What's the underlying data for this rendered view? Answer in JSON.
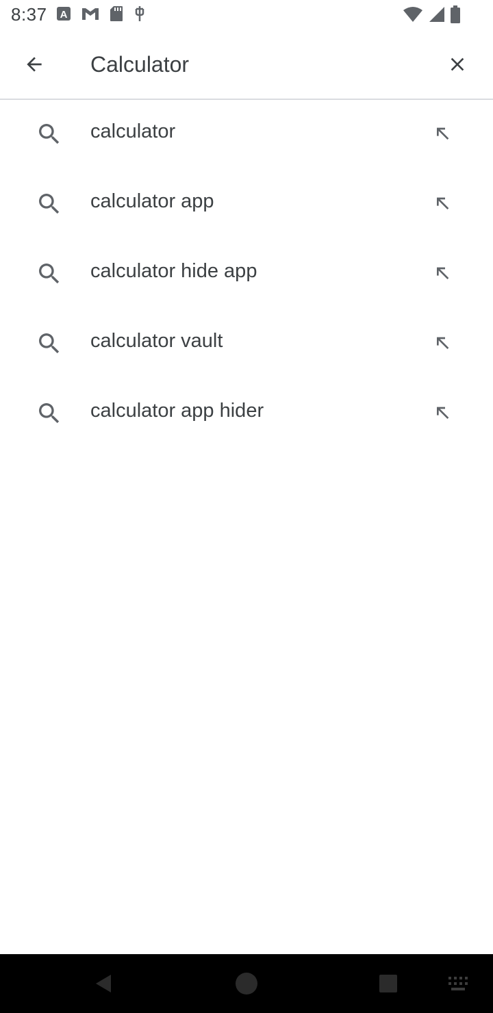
{
  "status_bar": {
    "time": "8:37",
    "left_icons": [
      "a-badge-icon",
      "gmail-icon",
      "sd-card-icon",
      "usb-icon"
    ],
    "right_icons": [
      "wifi-icon",
      "signal-icon",
      "battery-icon"
    ]
  },
  "search": {
    "query": "Calculator",
    "back_icon": "arrow-back-icon",
    "clear_icon": "close-icon"
  },
  "suggestions": [
    {
      "text": "calculator"
    },
    {
      "text": "calculator app"
    },
    {
      "text": "calculator hide app"
    },
    {
      "text": "calculator vault"
    },
    {
      "text": "calculator app hider"
    }
  ],
  "nav_bar": {
    "buttons": [
      "back-triangle-icon",
      "home-circle-icon",
      "recents-square-icon",
      "keyboard-icon"
    ]
  },
  "colors": {
    "text": "#3c4043",
    "icon": "#5f6368",
    "divider": "#dadce0",
    "nav_bg": "#000000"
  }
}
